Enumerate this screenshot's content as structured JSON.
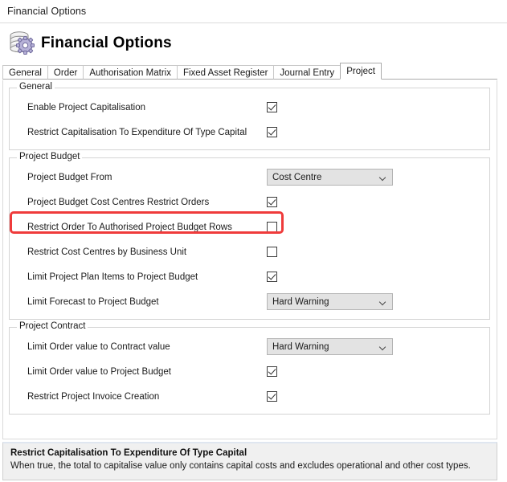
{
  "window": {
    "title": "Financial Options"
  },
  "header": {
    "title": "Financial Options",
    "icon": "database-gear-icon"
  },
  "tabs": [
    {
      "label": "General",
      "active": false
    },
    {
      "label": "Order",
      "active": false
    },
    {
      "label": "Authorisation Matrix",
      "active": false
    },
    {
      "label": "Fixed Asset Register",
      "active": false
    },
    {
      "label": "Journal Entry",
      "active": false
    },
    {
      "label": "Project",
      "active": true
    }
  ],
  "groups": [
    {
      "title": "General",
      "rows": [
        {
          "label": "Enable Project Capitalisation",
          "type": "checkbox",
          "checked": true
        },
        {
          "label": "Restrict Capitalisation To Expenditure Of Type Capital",
          "type": "checkbox",
          "checked": true,
          "highlighted": true
        }
      ]
    },
    {
      "title": "Project Budget",
      "rows": [
        {
          "label": "Project Budget From",
          "type": "dropdown",
          "value": "Cost Centre"
        },
        {
          "label": "Project Budget Cost Centres Restrict Orders",
          "type": "checkbox",
          "checked": true
        },
        {
          "label": "Restrict Order To Authorised Project Budget Rows",
          "type": "checkbox",
          "checked": false
        },
        {
          "label": "Restrict Cost Centres by Business Unit",
          "type": "checkbox",
          "checked": false
        },
        {
          "label": "Limit Project Plan Items to Project Budget",
          "type": "checkbox",
          "checked": true
        },
        {
          "label": "Limit Forecast to Project Budget",
          "type": "dropdown",
          "value": "Hard Warning"
        }
      ]
    },
    {
      "title": "Project Contract",
      "rows": [
        {
          "label": "Limit Order value to Contract value",
          "type": "dropdown",
          "value": "Hard Warning"
        },
        {
          "label": "Limit Order value to Project Budget",
          "type": "checkbox",
          "checked": true
        },
        {
          "label": "Restrict Project Invoice Creation",
          "type": "checkbox",
          "checked": true
        }
      ]
    }
  ],
  "help": {
    "title": "Restrict Capitalisation To Expenditure Of Type Capital",
    "text": "When true, the total to capitalise value only contains capital costs and excludes operational and other cost types."
  },
  "colors": {
    "highlight": "#ef3b3b",
    "dropdown_bg": "#e3e3e3",
    "help_bg": "#f0f0f0"
  }
}
